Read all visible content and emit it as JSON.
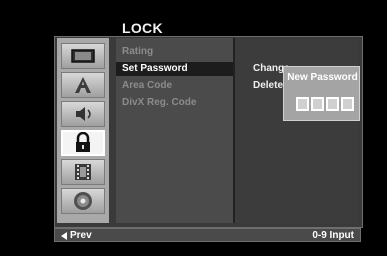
{
  "menu": {
    "title": "LOCK",
    "items": [
      {
        "label": "Rating",
        "state": "dimmed"
      },
      {
        "label": "Set Password",
        "state": "selected"
      },
      {
        "label": "Area Code",
        "state": "dimmed"
      },
      {
        "label": "DivX Reg. Code",
        "state": "dimmed"
      }
    ]
  },
  "sidebar": {
    "icons": [
      {
        "name": "tv-screen-icon"
      },
      {
        "name": "language-a-icon"
      },
      {
        "name": "audio-speaker-icon"
      },
      {
        "name": "padlock-icon",
        "active": true
      },
      {
        "name": "film-strip-icon"
      },
      {
        "name": "disc-icon"
      }
    ]
  },
  "options": {
    "change": "Change",
    "delete": "Delete"
  },
  "popup": {
    "title": "New Password",
    "boxes": 4
  },
  "footer": {
    "prev": "Prev",
    "hint": "0-9 Input"
  }
}
